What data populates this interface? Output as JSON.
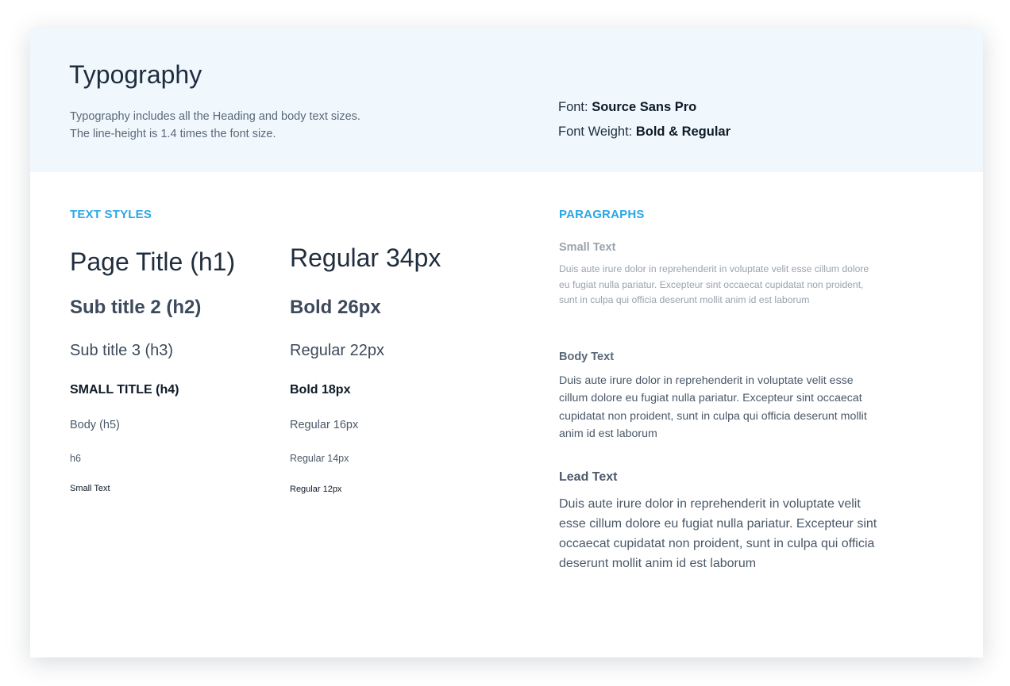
{
  "header": {
    "title": "Typography",
    "intro_line_1": "Typography includes all the Heading and body text sizes.",
    "intro_line_2": "The line-height is 1.4 times the font size.",
    "font_label": "Font: ",
    "font_value": "Source Sans Pro",
    "weight_label": "Font Weight: ",
    "weight_value": "Bold & Regular"
  },
  "text_styles": {
    "heading": "TEXT STYLES",
    "names": [
      "Page Title (h1)",
      "Sub title 2 (h2)",
      "Sub title 3 (h3)",
      "SMALL TITLE (h4)",
      "Body (h5)",
      "h6",
      "Small Text"
    ],
    "specs": [
      "Regular 34px",
      "Bold 26px",
      "Regular 22px",
      "Bold 18px",
      "Regular 16px",
      "Regular 14px",
      "Regular 12px"
    ]
  },
  "paragraphs": {
    "heading": "PARAGRAPHS",
    "small": {
      "label": "Small Text",
      "text": "Duis aute irure dolor in reprehenderit in voluptate velit esse cillum dolore eu fugiat nulla pariatur. Excepteur sint occaecat cupidatat non proident, sunt in culpa qui officia deserunt mollit anim id est laborum"
    },
    "body": {
      "label": "Body Text",
      "text": "Duis aute irure dolor in reprehenderit in voluptate velit esse cillum dolore eu fugiat nulla pariatur. Excepteur sint occaecat cupidatat non proident, sunt in culpa qui officia deserunt mollit anim id est laborum"
    },
    "lead": {
      "label": "Lead Text",
      "text": "Duis aute irure dolor in reprehenderit in voluptate velit esse cillum dolore eu fugiat nulla pariatur. Excepteur sint occaecat cupidatat non proident, sunt in culpa qui officia deserunt mollit anim id est laborum"
    }
  },
  "colors": {
    "accent": "#2aa7e6",
    "header_bg": "#f0f8fd",
    "text_dark": "#1f2d3d",
    "text_muted": "#9aa3ad"
  }
}
